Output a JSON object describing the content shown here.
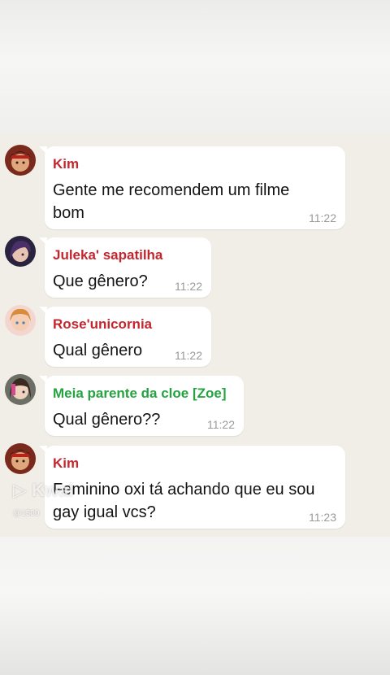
{
  "colors": {
    "kim": "#c4262e",
    "juleka": "#c4262e",
    "rose": "#c4262e",
    "zoe": "#24a340",
    "bubble": "#ffffff",
    "timestamp": "#9a9a9a"
  },
  "messages": [
    {
      "sender": "Kim",
      "text_line1": "Gente me recomendem um filme",
      "text_line2": "bom",
      "time": "11:22",
      "avatar": "kim-avatar-icon"
    },
    {
      "sender": "Juleka' sapatilha",
      "text_line1": "Que gênero?",
      "time": "11:22",
      "avatar": "juleka-avatar-icon"
    },
    {
      "sender": "Rose'unicornia",
      "text_line1": "Qual gênero",
      "time": "11:22",
      "avatar": "rose-avatar-icon"
    },
    {
      "sender": "Meia parente da cloe [Zoe]",
      "text_line1": "Qual gênero??",
      "time": "11:22",
      "avatar": "zoe-avatar-icon"
    },
    {
      "sender": "Kim",
      "text_line1": "Feminino oxi tá achando que eu sou",
      "text_line2": "gay igual vcs?",
      "time": "11:23",
      "avatar": "kim-avatar-icon"
    }
  ],
  "watermark": {
    "brand": "Kwai",
    "id": "@1500"
  }
}
